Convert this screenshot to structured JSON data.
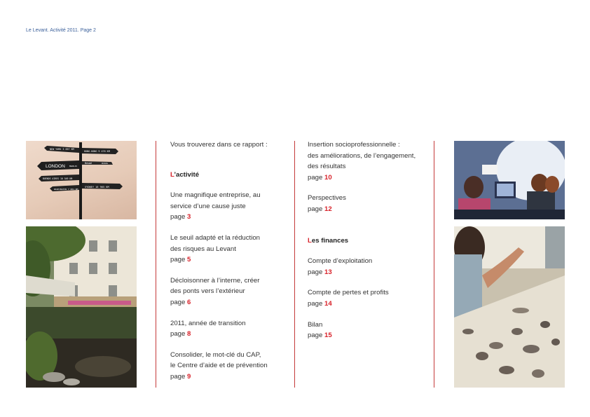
{
  "header": {
    "text": "Le Levant. Activité 2011. Page 2"
  },
  "left_column": {
    "intro": "Vous trouverez dans ce rapport :",
    "section1": {
      "first_letter": "L",
      "rest": "’activité"
    },
    "items": [
      {
        "title_lines": [
          "Une magnifique entreprise, au",
          "service d’une cause juste"
        ],
        "page_label": "page",
        "page": "3"
      },
      {
        "title_lines": [
          "Le seuil adapté et la réduction",
          "des risques au Levant"
        ],
        "page_label": "page",
        "page": "5"
      },
      {
        "title_lines": [
          "Décloisonner à l’interne, créer",
          "des ponts vers l’extérieur"
        ],
        "page_label": "page",
        "page": "6"
      },
      {
        "title_lines": [
          "2011, année de transition"
        ],
        "page_label": "page",
        "page": "8"
      },
      {
        "title_lines": [
          "Consolider, le mot-clé du CAP,",
          "le Centre d’aide et de prévention"
        ],
        "page_label": "page",
        "page": "9"
      }
    ]
  },
  "right_column": {
    "items_a": [
      {
        "title_lines": [
          "Insertion socioprofessionnelle :",
          "des améliorations, de l’engagement,",
          "des résultats"
        ],
        "page_label": "page",
        "page": "10"
      },
      {
        "title_lines": [
          "Perspectives"
        ],
        "page_label": "page",
        "page": "12"
      }
    ],
    "section2": {
      "first_letter": "L",
      "rest": "es finances"
    },
    "items_b": [
      {
        "title_lines": [
          "Compte d’exploitation"
        ],
        "page_label": "page",
        "page": "13"
      },
      {
        "title_lines": [
          "Compte de pertes et profits"
        ],
        "page_label": "page",
        "page": "14"
      },
      {
        "title_lines": [
          "Bilan"
        ],
        "page_label": "page",
        "page": "15"
      }
    ]
  },
  "signpost_signs": [
    "NEW YORK 3 657 KM",
    "HONG-KONG 9 476 KM",
    "LONDON",
    "BERLIN",
    "Bessel",
    "ROMA",
    "BUENOS AIRES 10 549 KM",
    "SYDNEY 16 965 KM",
    "WASHINGTON 7 001 KM"
  ],
  "colors": {
    "accent": "#d8222a",
    "rule": "#c43a3a",
    "header": "#3a5f9a"
  }
}
